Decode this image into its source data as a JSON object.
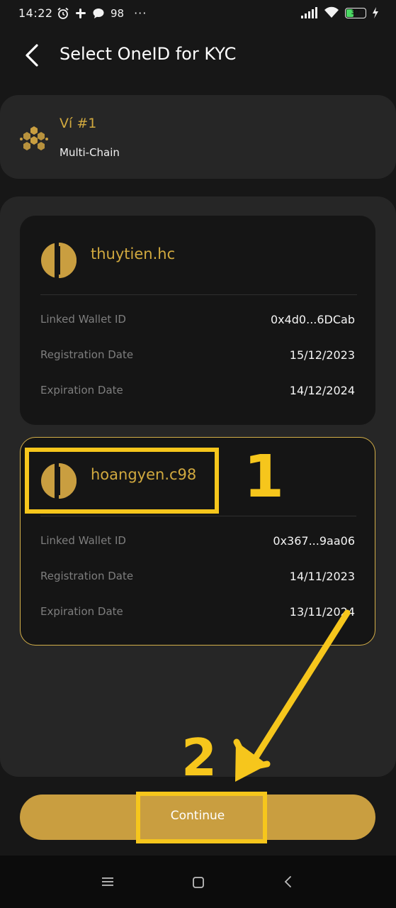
{
  "status_bar": {
    "time": "14:22",
    "left_icons": [
      "alarm-icon",
      "slack-icon",
      "chat-bubble-icon",
      "98-app-icon",
      "more-dots-icon"
    ],
    "app_label": "98",
    "dots": "···",
    "battery": "37",
    "right_icons": [
      "signal-icon",
      "wifi-icon",
      "battery-icon",
      "charging-icon"
    ]
  },
  "header": {
    "title": "Select OneID for KYC",
    "back_icon": "back-chevron-icon"
  },
  "wallet": {
    "name": "Ví #1",
    "chain": "Multi-Chain",
    "icon": "hexagon-cluster-icon"
  },
  "oneids": [
    {
      "name": "thuytien.hc",
      "selected": false,
      "rows": [
        {
          "label": "Linked Wallet ID",
          "value": "0x4d0...6DCab"
        },
        {
          "label": "Registration Date",
          "value": "15/12/2023"
        },
        {
          "label": "Expiration Date",
          "value": "14/12/2024"
        }
      ]
    },
    {
      "name": "hoangyen.c98",
      "selected": true,
      "rows": [
        {
          "label": "Linked Wallet ID",
          "value": "0x367...9aa06"
        },
        {
          "label": "Registration Date",
          "value": "14/11/2023"
        },
        {
          "label": "Expiration Date",
          "value": "13/11/2024"
        }
      ]
    }
  ],
  "annotations": {
    "step1": "1",
    "step2": "2"
  },
  "continue_label": "Continue",
  "colors": {
    "background": "#171717",
    "panel": "#262626",
    "card": "#151515",
    "accent_gold": "#d1a93f",
    "button_gold": "#c99e40",
    "annotation_yellow": "#f6c61c"
  },
  "nav_bar": [
    "menu-icon",
    "home-square-icon",
    "back-triangle-icon"
  ]
}
